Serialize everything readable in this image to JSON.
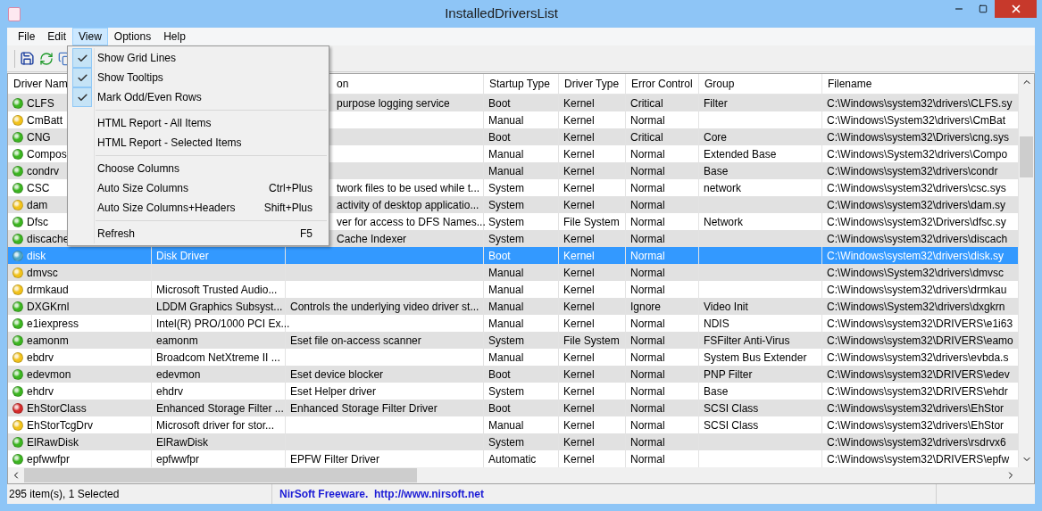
{
  "window": {
    "title": "InstalledDriversList"
  },
  "menu_bar": [
    {
      "label": "File",
      "open": false
    },
    {
      "label": "Edit",
      "open": false
    },
    {
      "label": "View",
      "open": true
    },
    {
      "label": "Options",
      "open": false
    },
    {
      "label": "Help",
      "open": false
    }
  ],
  "view_menu": [
    {
      "kind": "check",
      "label": "Show Grid Lines",
      "checked": true
    },
    {
      "kind": "check",
      "label": "Show Tooltips",
      "checked": true
    },
    {
      "kind": "check",
      "label": "Mark Odd/Even Rows",
      "checked": true
    },
    {
      "kind": "separator"
    },
    {
      "kind": "item",
      "label": "HTML Report - All Items"
    },
    {
      "kind": "item",
      "label": "HTML Report - Selected Items"
    },
    {
      "kind": "separator"
    },
    {
      "kind": "item",
      "label": "Choose Columns"
    },
    {
      "kind": "item",
      "label": "Auto Size Columns",
      "shortcut": "Ctrl+Plus"
    },
    {
      "kind": "item",
      "label": "Auto Size Columns+Headers",
      "shortcut": "Shift+Plus"
    },
    {
      "kind": "separator"
    },
    {
      "kind": "item",
      "label": "Refresh",
      "shortcut": "F5"
    }
  ],
  "table": {
    "columns": [
      "Driver Nam",
      "",
      "on",
      "Startup Type",
      "Driver Type",
      "Error Control",
      "Group",
      "Filename"
    ],
    "rows": [
      {
        "name": "CLFS",
        "color": "#3cb521",
        "selected": false,
        "description": "purpose logging service",
        "startup_type": "Boot",
        "driver_type": "Kernel",
        "error_control": "Critical",
        "group": "Filter",
        "filename": "C:\\Windows\\system32\\drivers\\CLFS.sy"
      },
      {
        "name": "CmBatt",
        "color": "#f2c21a",
        "selected": false,
        "startup_type": "Manual",
        "driver_type": "Kernel",
        "error_control": "Normal",
        "filename": "C:\\Windows\\System32\\drivers\\CmBat"
      },
      {
        "name": "CNG",
        "color": "#3cb521",
        "selected": false,
        "startup_type": "Boot",
        "driver_type": "Kernel",
        "error_control": "Critical",
        "group": "Core",
        "filename": "C:\\Windows\\system32\\Drivers\\cng.sys"
      },
      {
        "name": "Compos",
        "color": "#3cb521",
        "selected": false,
        "startup_type": "Manual",
        "driver_type": "Kernel",
        "error_control": "Normal",
        "group": "Extended Base",
        "filename": "C:\\Windows\\System32\\drivers\\Compo"
      },
      {
        "name": "condrv",
        "color": "#3cb521",
        "selected": false,
        "startup_type": "Manual",
        "driver_type": "Kernel",
        "error_control": "Normal",
        "group": "Base",
        "filename": "C:\\Windows\\system32\\drivers\\condr"
      },
      {
        "name": "CSC",
        "color": "#3cb521",
        "selected": false,
        "description": "twork files to be used while t...",
        "startup_type": "System",
        "driver_type": "Kernel",
        "error_control": "Normal",
        "group": "network",
        "filename": "C:\\Windows\\system32\\drivers\\csc.sys"
      },
      {
        "name": "dam",
        "color": "#f2c21a",
        "selected": false,
        "description": "activity of desktop applicatio...",
        "startup_type": "System",
        "driver_type": "Kernel",
        "error_control": "Normal",
        "filename": "C:\\Windows\\system32\\drivers\\dam.sy"
      },
      {
        "name": "Dfsc",
        "color": "#3cb521",
        "selected": false,
        "description": "ver for access to DFS Names...",
        "startup_type": "System",
        "driver_type": "File System",
        "error_control": "Normal",
        "group": "Network",
        "filename": "C:\\Windows\\system32\\Drivers\\dfsc.sy"
      },
      {
        "name": "discache",
        "color": "#3cb521",
        "selected": false,
        "description": "Cache Indexer",
        "startup_type": "System",
        "driver_type": "Kernel",
        "error_control": "Normal",
        "filename": "C:\\Windows\\system32\\drivers\\discach"
      },
      {
        "name": "disk",
        "color": "#4fa8c8",
        "selected": true,
        "display_name": "Disk Driver",
        "startup_type": "Boot",
        "driver_type": "Kernel",
        "error_control": "Normal",
        "filename": "C:\\Windows\\system32\\drivers\\disk.sy"
      },
      {
        "name": "dmvsc",
        "color": "#f2c21a",
        "selected": false,
        "startup_type": "Manual",
        "driver_type": "Kernel",
        "error_control": "Normal",
        "filename": "C:\\Windows\\System32\\drivers\\dmvsc"
      },
      {
        "name": "drmkaud",
        "color": "#f2c21a",
        "selected": false,
        "display_name": "Microsoft Trusted Audio...",
        "startup_type": "Manual",
        "driver_type": "Kernel",
        "error_control": "Normal",
        "filename": "C:\\Windows\\system32\\drivers\\drmkau"
      },
      {
        "name": "DXGKrnl",
        "color": "#3cb521",
        "selected": false,
        "display_name": "LDDM Graphics Subsyst...",
        "description": "Controls the underlying video driver st...",
        "startup_type": "Manual",
        "driver_type": "Kernel",
        "error_control": "Ignore",
        "group": "Video Init",
        "filename": "C:\\Windows\\System32\\drivers\\dxgkrn"
      },
      {
        "name": "e1iexpress",
        "color": "#3cb521",
        "selected": false,
        "display_name": "Intel(R) PRO/1000 PCI Ex...",
        "startup_type": "Manual",
        "driver_type": "Kernel",
        "error_control": "Normal",
        "group": "NDIS",
        "filename": "C:\\Windows\\system32\\DRIVERS\\e1i63"
      },
      {
        "name": "eamonm",
        "color": "#3cb521",
        "selected": false,
        "display_name": "eamonm",
        "description": "Eset file on-access scanner",
        "startup_type": "System",
        "driver_type": "File System",
        "error_control": "Normal",
        "group": "FSFilter Anti-Virus",
        "filename": "C:\\Windows\\system32\\DRIVERS\\eamo"
      },
      {
        "name": "ebdrv",
        "color": "#f2c21a",
        "selected": false,
        "display_name": "Broadcom NetXtreme II ...",
        "startup_type": "Manual",
        "driver_type": "Kernel",
        "error_control": "Normal",
        "group": "System Bus Extender",
        "filename": "C:\\Windows\\system32\\drivers\\evbda.s"
      },
      {
        "name": "edevmon",
        "color": "#3cb521",
        "selected": false,
        "display_name": "edevmon",
        "description": "Eset device blocker",
        "startup_type": "Boot",
        "driver_type": "Kernel",
        "error_control": "Normal",
        "group": "PNP Filter",
        "filename": "C:\\Windows\\system32\\DRIVERS\\edev"
      },
      {
        "name": "ehdrv",
        "color": "#3cb521",
        "selected": false,
        "display_name": "ehdrv",
        "description": "Eset Helper driver",
        "startup_type": "System",
        "driver_type": "Kernel",
        "error_control": "Normal",
        "group": "Base",
        "filename": "C:\\Windows\\system32\\DRIVERS\\ehdr"
      },
      {
        "name": "EhStorClass",
        "color": "#d42a2a",
        "selected": false,
        "display_name": "Enhanced Storage Filter ...",
        "description": "Enhanced Storage Filter Driver",
        "startup_type": "Boot",
        "driver_type": "Kernel",
        "error_control": "Normal",
        "group": "SCSI Class",
        "filename": "C:\\Windows\\system32\\drivers\\EhStor"
      },
      {
        "name": "EhStorTcgDrv",
        "color": "#f2c21a",
        "selected": false,
        "display_name": "Microsoft driver for stor...",
        "startup_type": "Manual",
        "driver_type": "Kernel",
        "error_control": "Normal",
        "group": "SCSI Class",
        "filename": "C:\\Windows\\system32\\drivers\\EhStor"
      },
      {
        "name": "ElRawDisk",
        "color": "#3cb521",
        "selected": false,
        "display_name": "ElRawDisk",
        "startup_type": "System",
        "driver_type": "Kernel",
        "error_control": "Normal",
        "filename": "C:\\Windows\\system32\\drivers\\rsdrvx6"
      },
      {
        "name": "epfwwfpr",
        "color": "#3cb521",
        "selected": false,
        "display_name": "epfwwfpr",
        "description": "EPFW Filter Driver",
        "startup_type": "Automatic",
        "driver_type": "Kernel",
        "error_control": "Normal",
        "filename": "C:\\Windows\\system32\\DRIVERS\\epfw"
      }
    ]
  },
  "status_bar": {
    "count": "295 item(s), 1 Selected",
    "credit": "NirSoft Freeware.  http://www.nirsoft.net"
  }
}
